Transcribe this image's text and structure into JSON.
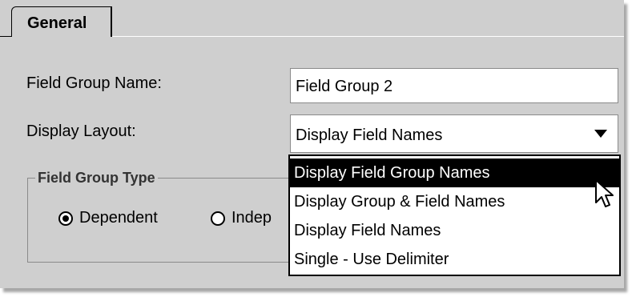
{
  "tabs": [
    {
      "label": "General",
      "active": true
    }
  ],
  "form": {
    "field_group_name_label": "Field Group Name:",
    "field_group_name_value": "Field Group 2",
    "display_layout_label": "Display Layout:",
    "display_layout_value": "Display Field Names"
  },
  "field_group_type": {
    "title": "Field Group Type",
    "options": [
      {
        "label": "Dependent",
        "checked": true
      },
      {
        "label": "Indep",
        "checked": false
      }
    ]
  },
  "dropdown": {
    "options": [
      {
        "label": "Display Field Group Names",
        "highlighted": true
      },
      {
        "label": "Display Group & Field Names",
        "highlighted": false
      },
      {
        "label": "Display Field Names",
        "highlighted": false
      },
      {
        "label": "Single - Use Delimiter",
        "highlighted": false
      }
    ]
  },
  "colors": {
    "panel_background": "#cfcfcf",
    "highlight": "#000000",
    "highlight_text": "#ffffff"
  },
  "icons": {
    "cursor": "arrow-cursor-icon",
    "combo_arrow": "triangle-down-icon"
  }
}
